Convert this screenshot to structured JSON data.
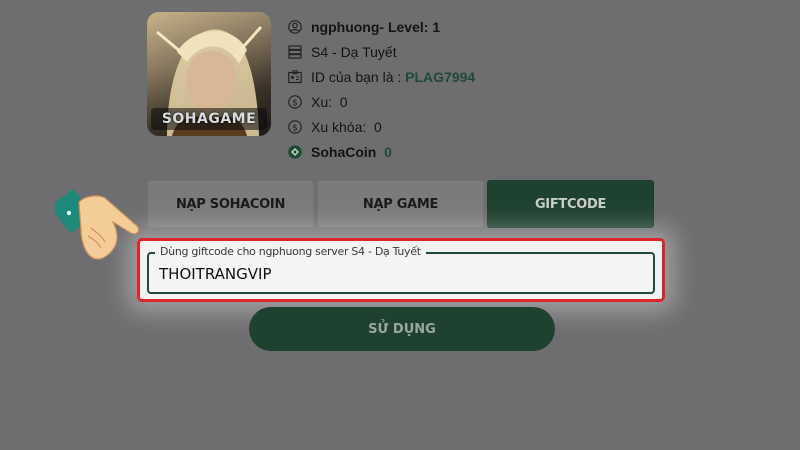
{
  "avatar": {
    "logo_text": "SOHAGAME"
  },
  "profile": {
    "username_level": "ngphuong- Level: 1",
    "server": "S4 - Dạ Tuyết",
    "id_label": "ID của bạn là :",
    "id_value": "PLAG7994",
    "xu_label": "Xu:",
    "xu_value": "0",
    "xu_locked_label": "Xu khóa:",
    "xu_locked_value": "0",
    "sohacoin_label": "SohaCoin",
    "sohacoin_value": "0"
  },
  "tabs": [
    {
      "label": "NẠP SOHACOIN",
      "active": false
    },
    {
      "label": "NẠP GAME",
      "active": false
    },
    {
      "label": "GIFTCODE",
      "active": true
    }
  ],
  "giftcode": {
    "field_label": "Dùng giftcode cho ngphuong server S4 - Dạ Tuyết",
    "value": "THOITRANGVIP"
  },
  "submit_label": "SỬ DỤNG",
  "colors": {
    "background": "#6e6e70",
    "accent_green": "#1f4230",
    "highlight_red": "#e0242c"
  },
  "icons": [
    "user-icon",
    "server-icon",
    "id-card-icon",
    "dollar-icon",
    "dollar-icon",
    "sohacoin-icon",
    "pointing-hand-icon"
  ]
}
